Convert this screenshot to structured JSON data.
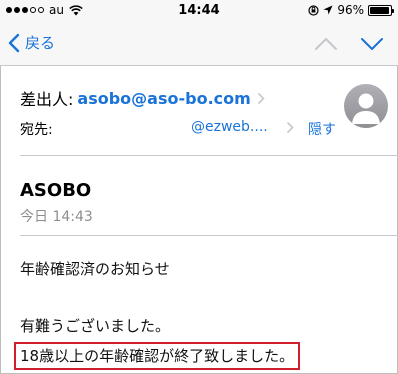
{
  "status_bar": {
    "carrier": "au",
    "time": "14:44",
    "battery": "96%",
    "signal_dots": [
      true,
      true,
      true,
      false,
      false
    ],
    "battery_level": 0.96
  },
  "nav": {
    "back_label": "戻る",
    "accent_color": "#1a73d9"
  },
  "header": {
    "from_label": "差出人:",
    "from_address": "asobo@aso-bo.com",
    "to_label": "宛先:",
    "to_address": "@ezweb....",
    "hide_label": "隠す"
  },
  "message": {
    "subject": "ASOBO",
    "date": "今日 14:43",
    "body": [
      "年齢確認済のお知らせ",
      "有難うございました。",
      "18歳以上の年齢確認が終了致しました。"
    ],
    "highlight_color": "#d01f2b"
  },
  "icons": {
    "back": "chevron-left-icon",
    "prev": "chevron-up-icon",
    "next": "chevron-down-icon",
    "avatar": "person-silhouette-icon"
  }
}
